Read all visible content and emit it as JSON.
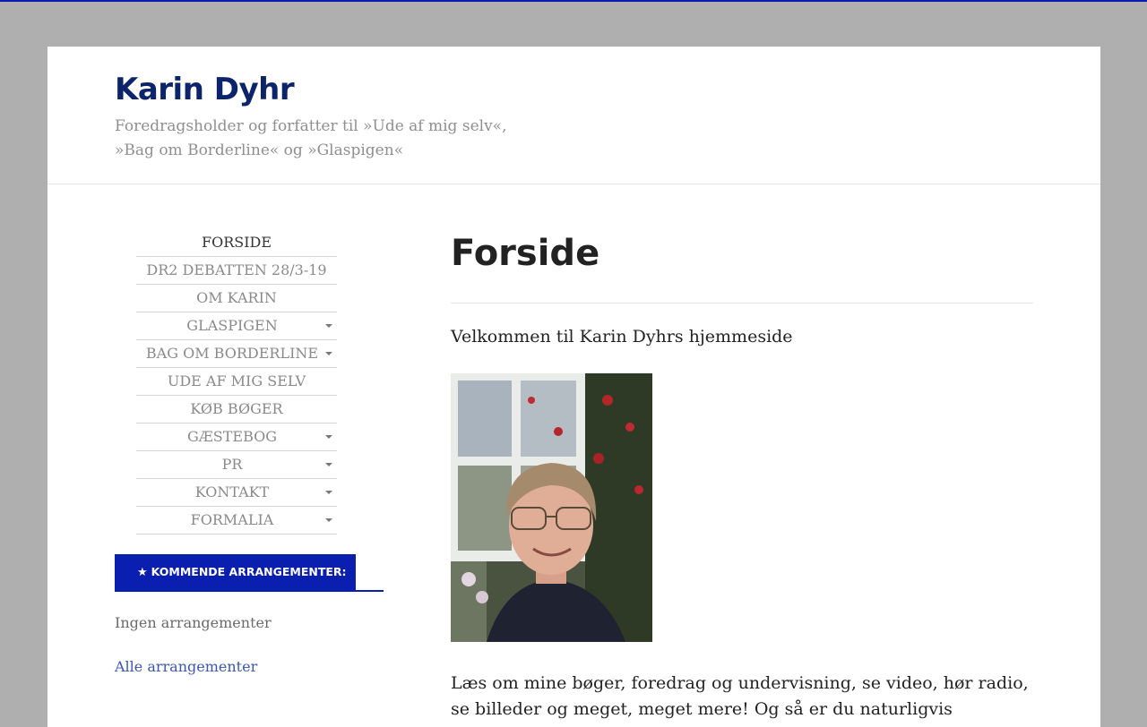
{
  "header": {
    "site_title": "Karin Dyhr",
    "site_description": "Foredragsholder og forfatter til »Ude af mig selv«, »Bag om Borderline« og »Glaspigen«"
  },
  "nav": {
    "items": [
      {
        "label": "FORSIDE",
        "has_submenu": false,
        "active": true
      },
      {
        "label": "DR2 DEBATTEN 28/3-19",
        "has_submenu": false
      },
      {
        "label": "OM KARIN",
        "has_submenu": false
      },
      {
        "label": "GLASPIGEN",
        "has_submenu": true
      },
      {
        "label": "BAG OM BORDERLINE",
        "has_submenu": true
      },
      {
        "label": "UDE AF MIG SELV",
        "has_submenu": false
      },
      {
        "label": "KØB BØGER",
        "has_submenu": false
      },
      {
        "label": "GÆSTEBOG",
        "has_submenu": true
      },
      {
        "label": "PR",
        "has_submenu": true
      },
      {
        "label": "KONTAKT",
        "has_submenu": true
      },
      {
        "label": "FORMALIA",
        "has_submenu": true
      }
    ]
  },
  "events_widget": {
    "icon": "star-icon",
    "title": "KOMMENDE ARRANGEMENTER:",
    "empty_text": "Ingen arrangementer",
    "all_link": "Alle arrangementer"
  },
  "main": {
    "title": "Forside",
    "welcome": "Velkommen til Karin Dyhrs hjemmeside",
    "body": "Læs om mine bøger, foredrag og undervisning, se video, hør radio, se billeder og meget, meget mere! Og så er du naturligvis"
  },
  "colors": {
    "accent": "#0a1fb0",
    "title": "#0b246b",
    "link": "#3a56b5",
    "background": "#afafaf"
  }
}
